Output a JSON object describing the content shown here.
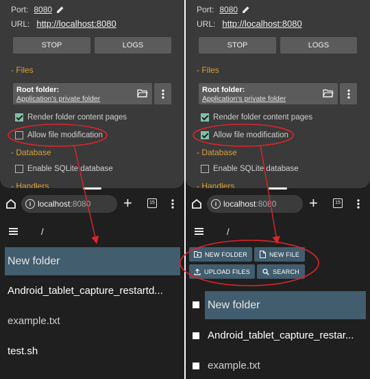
{
  "colors": {
    "annotation": "#e0242a",
    "accent": "#d9a13a",
    "selected": "#415d6e"
  },
  "left": {
    "port_label": "Port:",
    "port_value": "8080",
    "url_label": "URL:",
    "url_value": "http://localhost:8080",
    "stop_label": "STOP",
    "logs_label": "LOGS",
    "files_section": "- Files",
    "root_folder_label": "Root folder:",
    "root_folder_value": "Application's private folder",
    "render_pages_label": "Render folder content pages",
    "allow_modification_label": "Allow file modification",
    "database_section": "- Database",
    "sqlite_label": "Enable SQLite database",
    "handlers_section": "- Handlers",
    "address_host": "localhost",
    "address_port": ":8080",
    "tab_count": "15",
    "path": "/",
    "files": [
      "New folder",
      "Android_tablet_capture_restartd...",
      "example.txt",
      "test.sh"
    ]
  },
  "right": {
    "port_label": "Port:",
    "port_value": "8080",
    "url_label": "URL:",
    "url_value": "http://localhost:8080",
    "stop_label": "STOP",
    "logs_label": "LOGS",
    "files_section": "- Files",
    "root_folder_label": "Root folder:",
    "root_folder_value": "Application's private folder",
    "render_pages_label": "Render folder content pages",
    "allow_modification_label": "Allow file modification",
    "database_section": "- Database",
    "sqlite_label": "Enable SQLite database",
    "handlers_section": "- Handlers",
    "address_host": "localhost",
    "address_port": ":8080",
    "tab_count": "15",
    "path": "/",
    "new_folder_label": "NEW FOLDER",
    "new_file_label": "NEW FILE",
    "upload_files_label": "UPLOAD FILES",
    "search_label": "SEARCH",
    "files": [
      "New folder",
      "Android_tablet_capture_restar...",
      "example.txt"
    ]
  }
}
